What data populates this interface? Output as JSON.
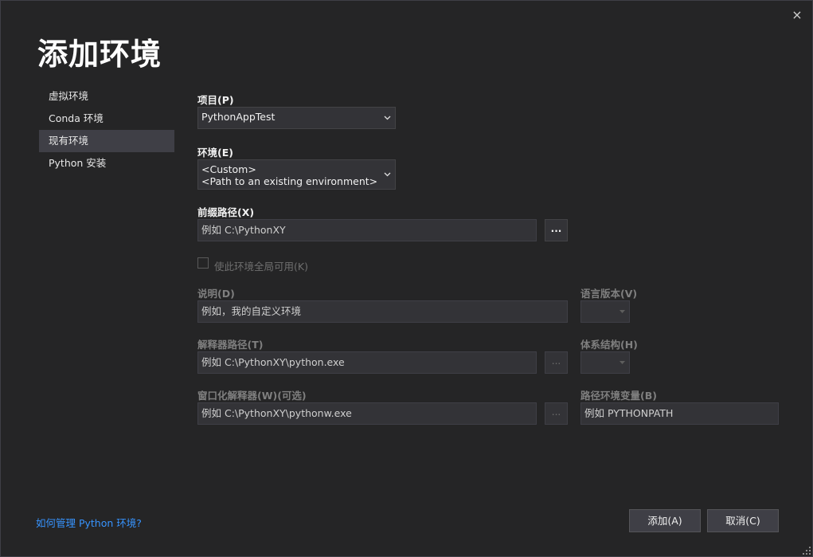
{
  "dialog": {
    "title": "添加环境",
    "close_icon": "×"
  },
  "nav": {
    "items": [
      {
        "label": "虚拟环境",
        "active": false
      },
      {
        "label": "Conda 环境",
        "active": false
      },
      {
        "label": "现有环境",
        "active": true
      },
      {
        "label": "Python 安装",
        "active": false
      }
    ]
  },
  "form": {
    "project_label": "项目(P)",
    "project_value": "PythonAppTest",
    "env_label": "环境(E)",
    "env_value_line1": "<Custom>",
    "env_value_line2": "<Path to an existing environment>",
    "prefix_label": "前缀路径(X)",
    "prefix_placeholder": "例如 C:\\PythonXY",
    "browse_label": "...",
    "global_label": "使此环境全局可用(K)",
    "desc_label": "说明(D)",
    "desc_placeholder": "例如，我的自定义环境",
    "lang_label": "语言版本(V)",
    "interp_label": "解释器路径(T)",
    "interp_placeholder": "例如 C:\\PythonXY\\python.exe",
    "arch_label": "体系结构(H)",
    "winterp_label": "窗口化解释器(W)(可选)",
    "winterp_placeholder": "例如 C:\\PythonXY\\pythonw.exe",
    "pathvar_label": "路径环境变量(B)",
    "pathvar_placeholder": "例如 PYTHONPATH"
  },
  "footer": {
    "help_link": "如何管理 Python 环境?",
    "add_button": "添加(A)",
    "cancel_button": "取消(C)"
  },
  "colors": {
    "background": "#252526",
    "panel_selected": "#3f3f46",
    "link": "#3794ff"
  }
}
